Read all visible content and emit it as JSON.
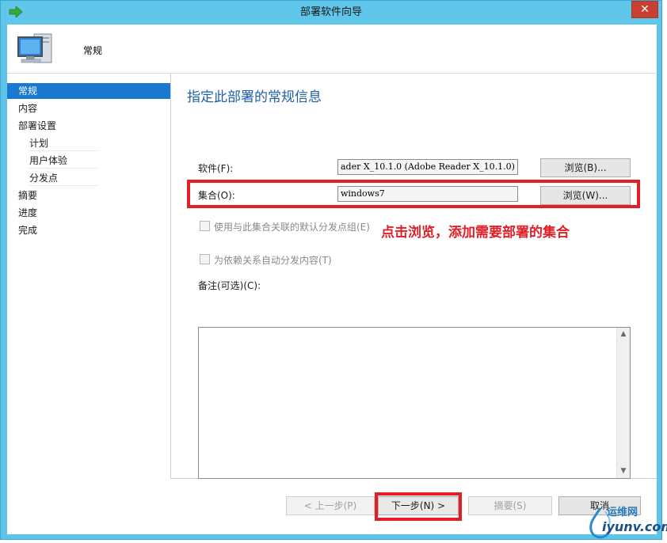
{
  "window": {
    "title": "部署软件向导",
    "close_symbol": "✕"
  },
  "header": {
    "page_name": "常规"
  },
  "nav": {
    "items": [
      {
        "label": "常规",
        "active": true
      },
      {
        "label": "内容"
      },
      {
        "label": "部署设置"
      },
      {
        "label": "计划"
      },
      {
        "label": "用户体验"
      },
      {
        "label": "分发点"
      },
      {
        "label": "摘要"
      },
      {
        "label": "进度"
      },
      {
        "label": "完成"
      }
    ]
  },
  "main": {
    "heading": "指定此部署的常规信息",
    "software_label": "软件(F):",
    "software_value": "ader X_10.1.0 (Adobe Reader X_10.1.0)",
    "software_browse": "浏览(B)...",
    "collection_label": "集合(O):",
    "collection_value": "windows7",
    "collection_browse": "浏览(W)...",
    "checkbox_default_dp": "使用与此集合关联的默认分发点组(E)",
    "checkbox_auto_distribute": "为依赖关系自动分发内容(T)",
    "comments_label": "备注(可选)(C):",
    "comments_value": ""
  },
  "annotation": {
    "text": "点击浏览，添加需要部署的集合",
    "color": "#e21e26"
  },
  "footer": {
    "prev": "< 上一步(P)",
    "next": "下一步(N) >",
    "summary": "摘要(S)",
    "cancel": "取消"
  },
  "watermark": {
    "line1": "运维网",
    "line2": "iyunv.com"
  },
  "colors": {
    "titlebar": "#60c6ea",
    "nav_active": "#1a78d1",
    "heading": "#1e5fa8",
    "highlight": "#e21e26"
  },
  "icons": [
    "app-arrow-icon",
    "computer-icon",
    "scroll-up-icon",
    "scroll-down-icon"
  ]
}
